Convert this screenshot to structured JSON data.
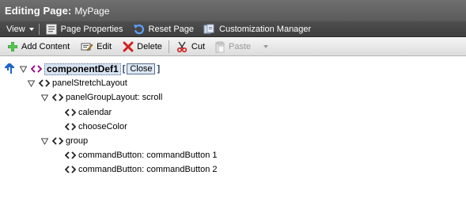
{
  "header": {
    "title_label": "Editing Page:",
    "title_value": "MyPage"
  },
  "menubar": {
    "view_label": "View",
    "page_properties_label": "Page Properties",
    "reset_page_label": "Reset Page",
    "customization_manager_label": "Customization Manager"
  },
  "toolbar": {
    "add_content_label": "Add Content",
    "edit_label": "Edit",
    "delete_label": "Delete",
    "cut_label": "Cut",
    "paste_label": "Paste"
  },
  "tree": {
    "root_label": "componentDef1",
    "close_label": "Close",
    "bracket_open": "[",
    "bracket_close": "]",
    "nodes": [
      {
        "label": "panelStretchLayout"
      },
      {
        "label": "panelGroupLayout: scroll"
      },
      {
        "label": "calendar"
      },
      {
        "label": "chooseColor"
      },
      {
        "label": "group"
      },
      {
        "label": "commandButton: commandButton 1"
      },
      {
        "label": "commandButton: commandButton 2"
      }
    ]
  },
  "colors": {
    "titlebar": "#5f5f5f",
    "menubar": "#474747",
    "toolbar": "#e8e8e8",
    "selection": "#d7e3f1",
    "add_green": "#2e9a2e",
    "delete_red": "#d42020",
    "root_icon_magenta": "#a0148c"
  },
  "icons": {
    "up": "arrow-up-icon",
    "expanded": "triangle-down-icon",
    "tag": "tag-brackets-icon"
  }
}
